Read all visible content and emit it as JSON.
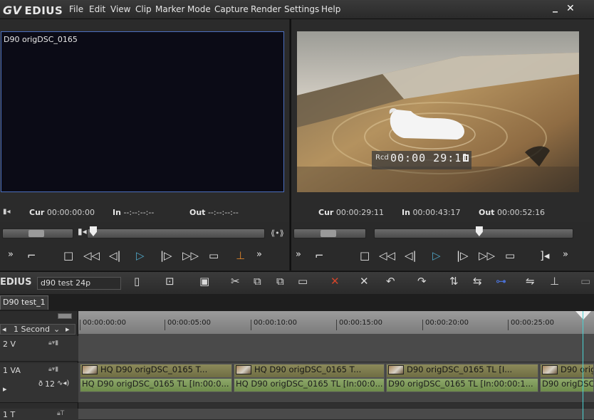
{
  "app": {
    "logo": "EDIUS",
    "brand_mark": "GV"
  },
  "menu": [
    "File",
    "Edit",
    "View",
    "Clip",
    "Marker",
    "Mode",
    "Capture",
    "Render",
    "Settings",
    "Help"
  ],
  "window": {
    "minimize": "_",
    "close": "✕"
  },
  "player": {
    "clip_name": "D90 origDSC_0165",
    "cur_label": "Cur",
    "cur": "00:00:00:00",
    "in_label": "In",
    "in": "--:--:--:--",
    "out_label": "Out",
    "out": "--:--:--:--",
    "position": 0.0
  },
  "recorder": {
    "overlay_label": "Rcd",
    "overlay_tc": "00:00 29:11",
    "cur_label": "Cur",
    "cur": "00:00:29:11",
    "in_label": "In",
    "in": "00:00:43:17",
    "out_label": "Out",
    "out": "00:00:52:16",
    "position": 0.53
  },
  "timeline": {
    "logo": "EDIUS",
    "sequence_field": "d90 test 24p",
    "tab": "D90 test_1",
    "scale": "1 Second",
    "ruler_ticks": [
      "00:00:00:00",
      "00:00:05:00",
      "00:00:10:00",
      "00:00:15:00",
      "00:00:20:00",
      "00:00:25:00"
    ],
    "tracks": [
      {
        "name": "2 V"
      },
      {
        "name": "1 VA",
        "audio_ch": "12"
      },
      {
        "name": "1 T"
      }
    ],
    "video_clips": [
      "HQ D90 origDSC_0165  T...",
      "HQ D90 origDSC_0165  T...",
      "D90 origDSC_0165  TL [I...",
      "D90 origD"
    ],
    "audio_clips": [
      "HQ D90 origDSC_0165  TL [In:00:0...",
      "HQ D90 origDSC_0165  TL [In:00:0...",
      "D90 origDSC_0165  TL [In:00:00:1...",
      "D90 origDSC"
    ]
  },
  "colors": {
    "accent": "#4fa3c3",
    "player_border": "#4b6fbf",
    "playhead": "#49d3d3",
    "delete": "#d2452b"
  }
}
